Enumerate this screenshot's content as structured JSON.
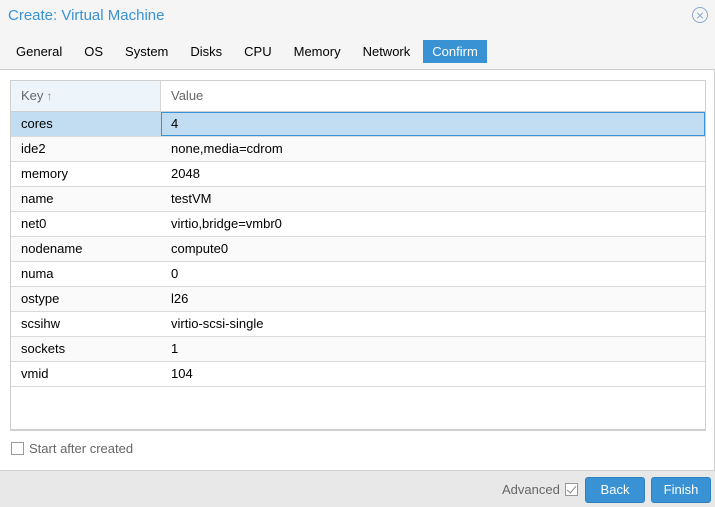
{
  "window": {
    "title": "Create: Virtual Machine"
  },
  "tabs": [
    {
      "label": "General"
    },
    {
      "label": "OS"
    },
    {
      "label": "System"
    },
    {
      "label": "Disks"
    },
    {
      "label": "CPU"
    },
    {
      "label": "Memory"
    },
    {
      "label": "Network"
    },
    {
      "label": "Confirm",
      "active": true
    }
  ],
  "grid": {
    "headers": {
      "key": "Key",
      "value": "Value",
      "sort_icon": "sort-ascending-icon"
    },
    "rows": [
      {
        "key": "cores",
        "value": "4",
        "selected": true
      },
      {
        "key": "ide2",
        "value": "none,media=cdrom"
      },
      {
        "key": "memory",
        "value": "2048"
      },
      {
        "key": "name",
        "value": "testVM"
      },
      {
        "key": "net0",
        "value": "virtio,bridge=vmbr0"
      },
      {
        "key": "nodename",
        "value": "compute0"
      },
      {
        "key": "numa",
        "value": "0"
      },
      {
        "key": "ostype",
        "value": "l26"
      },
      {
        "key": "scsihw",
        "value": "virtio-scsi-single"
      },
      {
        "key": "sockets",
        "value": "1"
      },
      {
        "key": "vmid",
        "value": "104"
      }
    ]
  },
  "start_after_created": {
    "label": "Start after created",
    "checked": false
  },
  "footer": {
    "advanced_label": "Advanced",
    "advanced_checked": true,
    "back_label": "Back",
    "finish_label": "Finish"
  },
  "colors": {
    "accent": "#3892d4",
    "selected_row": "#c2ddf2"
  }
}
